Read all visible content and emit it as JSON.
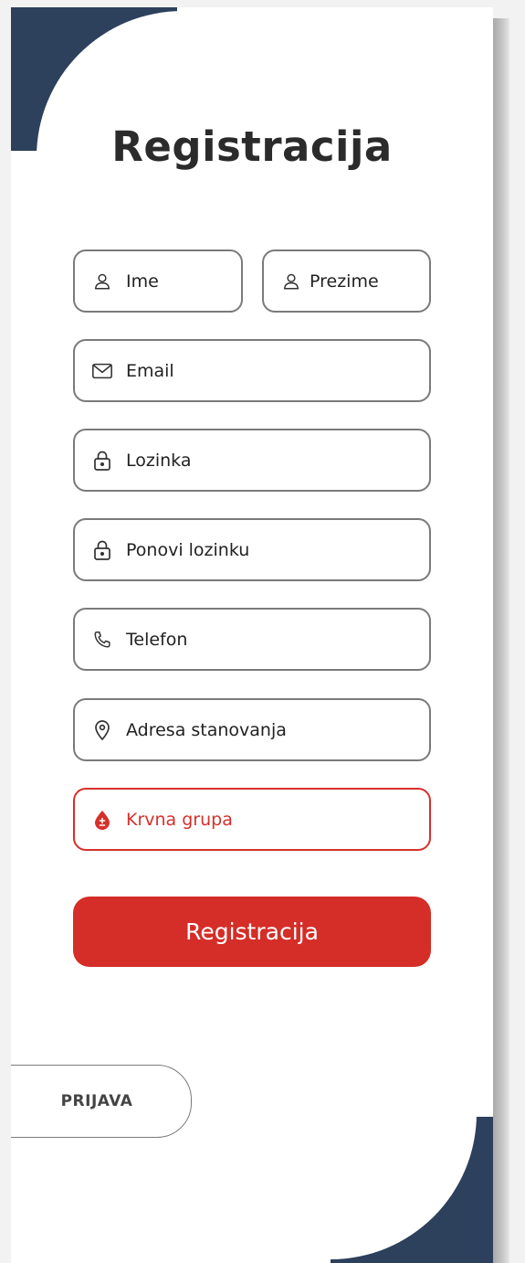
{
  "page": {
    "title": "Registracija"
  },
  "form": {
    "first_name": {
      "placeholder": "Ime",
      "icon": "user-icon"
    },
    "last_name": {
      "placeholder": "Prezime",
      "icon": "user-icon"
    },
    "email": {
      "placeholder": "Email",
      "icon": "mail-icon"
    },
    "password": {
      "placeholder": "Lozinka",
      "icon": "lock-icon"
    },
    "password_repeat": {
      "placeholder": "Ponovi lozinku",
      "icon": "lock-icon"
    },
    "phone": {
      "placeholder": "Telefon",
      "icon": "phone-icon"
    },
    "address": {
      "placeholder": "Adresa stanovanja",
      "icon": "location-pin-icon"
    },
    "blood_group": {
      "placeholder": "Krvna grupa",
      "icon": "blood-drop-icon"
    },
    "submit_label": "Registracija"
  },
  "login_tab": {
    "label": "PRIJAVA"
  },
  "colors": {
    "accent_red": "#d52d27",
    "navy": "#2d405c",
    "border_gray": "#7a7a7a",
    "title_text": "#2b2b2b"
  }
}
